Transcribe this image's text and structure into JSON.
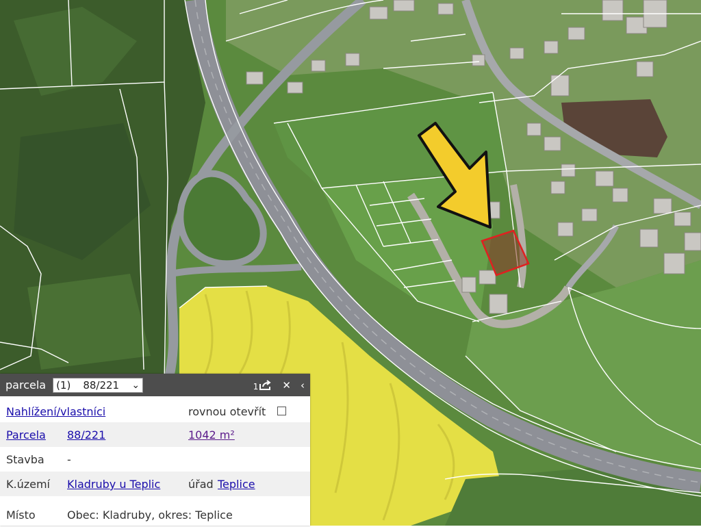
{
  "panel": {
    "title": "parcela",
    "select_count": "(1)",
    "select_value": "88/221",
    "badge_number": "1",
    "rows": {
      "view": {
        "label": "Nahlížení/vlastníci",
        "option": "rovnou otevřít"
      },
      "parcel": {
        "label": "Parcela",
        "value": "88/221",
        "area": "1042 m²"
      },
      "building": {
        "label": "Stavba",
        "value": "-"
      },
      "territory": {
        "label": "K.území",
        "value": "Kladruby u Teplic",
        "office_label": "úřad",
        "office_value": "Teplice"
      },
      "place": {
        "label": "Místo",
        "value": "Obec: Kladruby, okres: Teplice"
      }
    }
  },
  "map": {
    "colors": {
      "forest": "#3b5a2a",
      "field": "#5e8a40",
      "rapeseed": "#e6e043",
      "road": "#8e9097",
      "highlight": "#e02020",
      "arrow": "#f3cc2c"
    },
    "icons": [
      "highlighted-parcel",
      "pointer-arrow"
    ]
  }
}
